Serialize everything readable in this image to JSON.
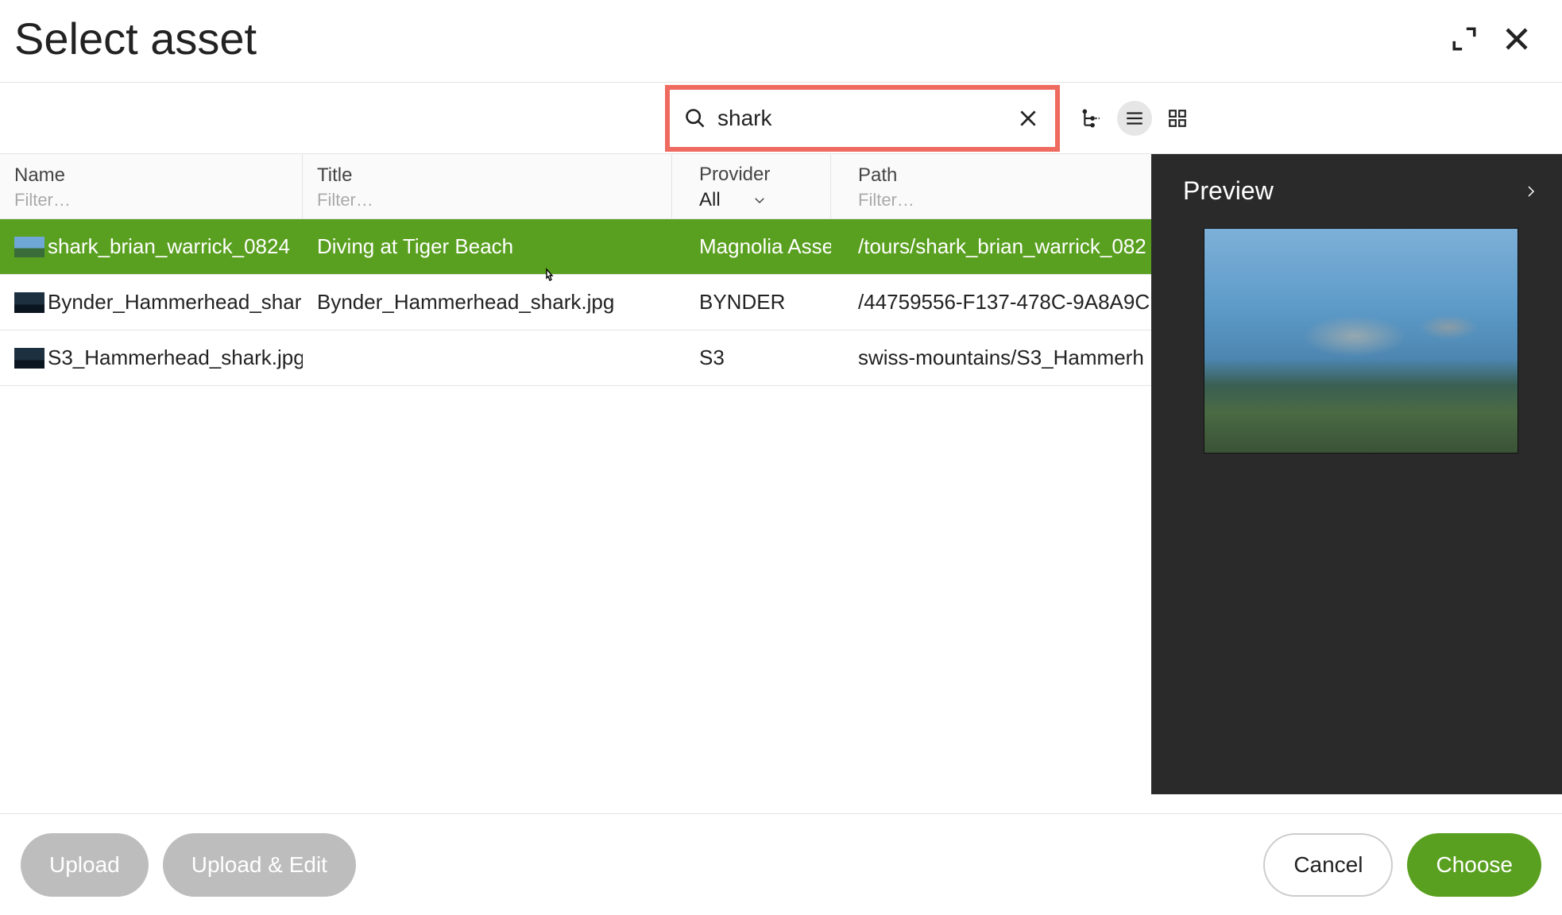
{
  "header": {
    "title": "Select asset"
  },
  "search": {
    "value": "shark"
  },
  "columns": {
    "name": {
      "label": "Name",
      "filter_placeholder": "Filter…"
    },
    "title": {
      "label": "Title",
      "filter_placeholder": "Filter…"
    },
    "provider": {
      "label": "Provider",
      "selected": "All"
    },
    "path": {
      "label": "Path",
      "filter_placeholder": "Filter…"
    }
  },
  "rows": [
    {
      "name": "shark_brian_warrick_0824",
      "title": "Diving at Tiger Beach",
      "provider": "Magnolia Asse",
      "path": "/tours/shark_brian_warrick_082",
      "selected": true,
      "thumb_variant": "light"
    },
    {
      "name": "Bynder_Hammerhead_shark",
      "title": "Bynder_Hammerhead_shark.jpg",
      "provider": "BYNDER",
      "path": "/44759556-F137-478C-9A8A9C",
      "selected": false,
      "thumb_variant": "dark"
    },
    {
      "name": "S3_Hammerhead_shark.jpg",
      "title": "",
      "provider": "S3",
      "path": "swiss-mountains/S3_Hammerh",
      "selected": false,
      "thumb_variant": "dark"
    }
  ],
  "preview": {
    "title": "Preview"
  },
  "footer": {
    "upload": "Upload",
    "upload_edit": "Upload & Edit",
    "cancel": "Cancel",
    "choose": "Choose"
  }
}
